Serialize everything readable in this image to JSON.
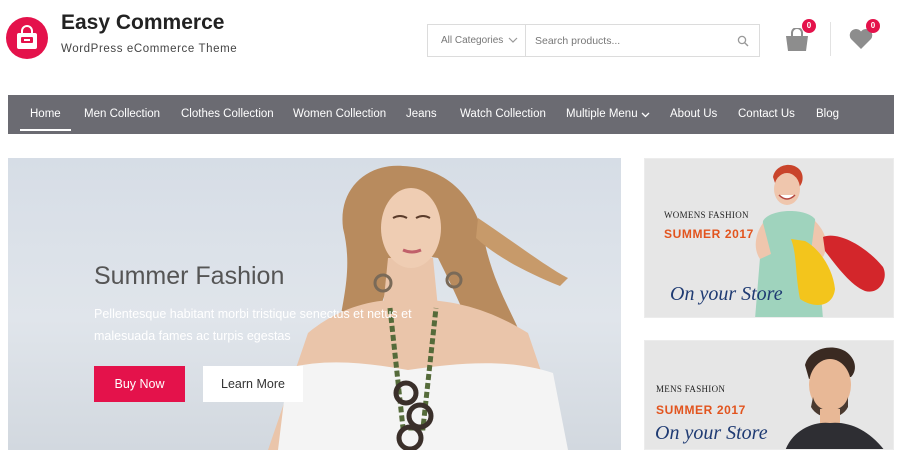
{
  "header": {
    "site_title": "Easy Commerce",
    "tagline": "WordPress eCommerce Theme",
    "logo_icon": "shopping-bag-icon",
    "brand_color": "#e4124b"
  },
  "search": {
    "category_label": "All Categories",
    "placeholder": "Search products..."
  },
  "header_icons": {
    "cart_count": "0",
    "wishlist_count": "0"
  },
  "nav": {
    "items": [
      {
        "label": "Home",
        "active": true
      },
      {
        "label": "Men Collection"
      },
      {
        "label": "Clothes Collection"
      },
      {
        "label": "Women Collection"
      },
      {
        "label": "Jeans"
      },
      {
        "label": "Watch Collection"
      },
      {
        "label": "Multiple Menu",
        "has_dropdown": true
      },
      {
        "label": "About Us"
      },
      {
        "label": "Contact Us"
      },
      {
        "label": "Blog"
      }
    ],
    "background": "#6b6b72"
  },
  "hero": {
    "title": "Summer Fashion",
    "text": "Pellentesque habitant morbi tristique senectus et netus et malesuada fames ac turpis egestas",
    "primary_button": "Buy Now",
    "secondary_button": "Learn More"
  },
  "banners": {
    "women": {
      "category": "WOMENS FASHION",
      "season": "SUMMER 2017",
      "script": "On your Store"
    },
    "men": {
      "category": "MENS FASHION",
      "season": "SUMMER 2017",
      "script": "On your Store"
    }
  }
}
